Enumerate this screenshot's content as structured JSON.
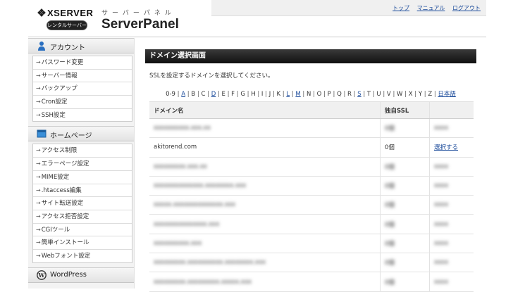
{
  "header": {
    "brand": "XSERVER",
    "rental_badge": "レンタルサーバー",
    "panel_sub": "サーバーパネル",
    "panel_title": "ServerPanel",
    "links": [
      "トップ",
      "マニュアル",
      "ログアウト"
    ]
  },
  "sidebar": {
    "account": {
      "title": "アカウント",
      "items": [
        "パスワード変更",
        "サーバー情報",
        "バックアップ",
        "Cron設定",
        "SSH設定"
      ]
    },
    "homepage": {
      "title": "ホームページ",
      "items": [
        "アクセス制限",
        "エラーページ設定",
        "MIME設定",
        ".htaccess編集",
        "サイト転送設定",
        "アクセス拒否設定",
        "CGIツール",
        "簡単インストール",
        "Webフォント設定"
      ]
    },
    "wordpress": {
      "title": "WordPress"
    }
  },
  "main": {
    "title": "ドメイン選択画面",
    "instruction": "SSLを設定するドメインを選択してください。",
    "alphabet": [
      "0-9",
      "A",
      "B",
      "C",
      "D",
      "E",
      "F",
      "G",
      "H",
      "I",
      "J",
      "K",
      "L",
      "M",
      "N",
      "O",
      "P",
      "Q",
      "R",
      "S",
      "T",
      "U",
      "V",
      "W",
      "X",
      "Y",
      "Z",
      "日本語"
    ],
    "linked_letters": [
      "A",
      "D",
      "L",
      "M",
      "S",
      "日本語"
    ],
    "table": {
      "headers": [
        "ドメイン名",
        "独自SSL",
        ""
      ],
      "rows": [
        {
          "domain": "akitorend.com",
          "ssl": "0個",
          "action": "選択する"
        }
      ]
    },
    "colors": {
      "title_bar": "#1a1a1a",
      "link": "#1a4a9a"
    }
  }
}
